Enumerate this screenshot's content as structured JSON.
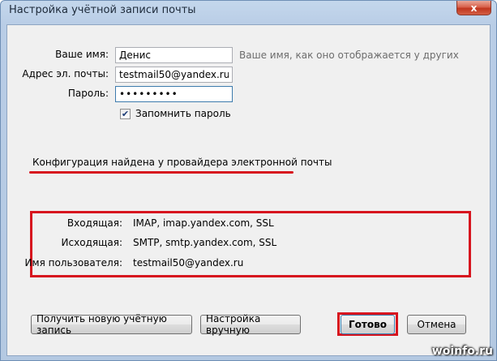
{
  "window": {
    "title": "Настройка учётной записи почты",
    "close_glyph": "x"
  },
  "form": {
    "name": {
      "label": "Ваше имя:",
      "value": "Денис",
      "hint": "Ваше имя, как оно отображается у других"
    },
    "email": {
      "label": "Адрес эл. почты:",
      "value": "testmail50@yandex.ru"
    },
    "password": {
      "label": "Пароль:",
      "value": "•••••••••"
    },
    "remember": {
      "label": "Запомнить пароль",
      "checked": true,
      "check_glyph": "✔"
    }
  },
  "status": {
    "text": "Конфигурация найдена у провайдера электронной почты"
  },
  "config": {
    "incoming": {
      "label": "Входящая:",
      "value": "IMAP, imap.yandex.com, SSL"
    },
    "outgoing": {
      "label": "Исходящая:",
      "value": "SMTP, smtp.yandex.com, SSL"
    },
    "username": {
      "label": "Имя пользователя:",
      "value": "testmail50@yandex.ru"
    }
  },
  "buttons": {
    "new_account": "Получить новую учётную запись",
    "manual": "Настройка вручную",
    "done": "Готово",
    "cancel": "Отмена"
  },
  "watermark": "woinfo.ru",
  "colors": {
    "highlight_red": "#d7141e",
    "titlebar": "#b9cde6",
    "dialog_bg": "#f0f0f0"
  }
}
